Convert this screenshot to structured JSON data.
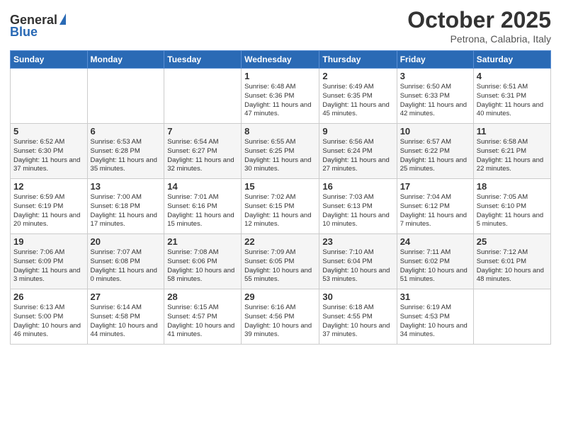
{
  "logo": {
    "general": "General",
    "blue": "Blue"
  },
  "header": {
    "month": "October 2025",
    "location": "Petrona, Calabria, Italy"
  },
  "days_of_week": [
    "Sunday",
    "Monday",
    "Tuesday",
    "Wednesday",
    "Thursday",
    "Friday",
    "Saturday"
  ],
  "weeks": [
    [
      {
        "day": "",
        "info": ""
      },
      {
        "day": "",
        "info": ""
      },
      {
        "day": "",
        "info": ""
      },
      {
        "day": "1",
        "info": "Sunrise: 6:48 AM\nSunset: 6:36 PM\nDaylight: 11 hours\nand 47 minutes."
      },
      {
        "day": "2",
        "info": "Sunrise: 6:49 AM\nSunset: 6:35 PM\nDaylight: 11 hours\nand 45 minutes."
      },
      {
        "day": "3",
        "info": "Sunrise: 6:50 AM\nSunset: 6:33 PM\nDaylight: 11 hours\nand 42 minutes."
      },
      {
        "day": "4",
        "info": "Sunrise: 6:51 AM\nSunset: 6:31 PM\nDaylight: 11 hours\nand 40 minutes."
      }
    ],
    [
      {
        "day": "5",
        "info": "Sunrise: 6:52 AM\nSunset: 6:30 PM\nDaylight: 11 hours\nand 37 minutes."
      },
      {
        "day": "6",
        "info": "Sunrise: 6:53 AM\nSunset: 6:28 PM\nDaylight: 11 hours\nand 35 minutes."
      },
      {
        "day": "7",
        "info": "Sunrise: 6:54 AM\nSunset: 6:27 PM\nDaylight: 11 hours\nand 32 minutes."
      },
      {
        "day": "8",
        "info": "Sunrise: 6:55 AM\nSunset: 6:25 PM\nDaylight: 11 hours\nand 30 minutes."
      },
      {
        "day": "9",
        "info": "Sunrise: 6:56 AM\nSunset: 6:24 PM\nDaylight: 11 hours\nand 27 minutes."
      },
      {
        "day": "10",
        "info": "Sunrise: 6:57 AM\nSunset: 6:22 PM\nDaylight: 11 hours\nand 25 minutes."
      },
      {
        "day": "11",
        "info": "Sunrise: 6:58 AM\nSunset: 6:21 PM\nDaylight: 11 hours\nand 22 minutes."
      }
    ],
    [
      {
        "day": "12",
        "info": "Sunrise: 6:59 AM\nSunset: 6:19 PM\nDaylight: 11 hours\nand 20 minutes."
      },
      {
        "day": "13",
        "info": "Sunrise: 7:00 AM\nSunset: 6:18 PM\nDaylight: 11 hours\nand 17 minutes."
      },
      {
        "day": "14",
        "info": "Sunrise: 7:01 AM\nSunset: 6:16 PM\nDaylight: 11 hours\nand 15 minutes."
      },
      {
        "day": "15",
        "info": "Sunrise: 7:02 AM\nSunset: 6:15 PM\nDaylight: 11 hours\nand 12 minutes."
      },
      {
        "day": "16",
        "info": "Sunrise: 7:03 AM\nSunset: 6:13 PM\nDaylight: 11 hours\nand 10 minutes."
      },
      {
        "day": "17",
        "info": "Sunrise: 7:04 AM\nSunset: 6:12 PM\nDaylight: 11 hours\nand 7 minutes."
      },
      {
        "day": "18",
        "info": "Sunrise: 7:05 AM\nSunset: 6:10 PM\nDaylight: 11 hours\nand 5 minutes."
      }
    ],
    [
      {
        "day": "19",
        "info": "Sunrise: 7:06 AM\nSunset: 6:09 PM\nDaylight: 11 hours\nand 3 minutes."
      },
      {
        "day": "20",
        "info": "Sunrise: 7:07 AM\nSunset: 6:08 PM\nDaylight: 11 hours\nand 0 minutes."
      },
      {
        "day": "21",
        "info": "Sunrise: 7:08 AM\nSunset: 6:06 PM\nDaylight: 10 hours\nand 58 minutes."
      },
      {
        "day": "22",
        "info": "Sunrise: 7:09 AM\nSunset: 6:05 PM\nDaylight: 10 hours\nand 55 minutes."
      },
      {
        "day": "23",
        "info": "Sunrise: 7:10 AM\nSunset: 6:04 PM\nDaylight: 10 hours\nand 53 minutes."
      },
      {
        "day": "24",
        "info": "Sunrise: 7:11 AM\nSunset: 6:02 PM\nDaylight: 10 hours\nand 51 minutes."
      },
      {
        "day": "25",
        "info": "Sunrise: 7:12 AM\nSunset: 6:01 PM\nDaylight: 10 hours\nand 48 minutes."
      }
    ],
    [
      {
        "day": "26",
        "info": "Sunrise: 6:13 AM\nSunset: 5:00 PM\nDaylight: 10 hours\nand 46 minutes."
      },
      {
        "day": "27",
        "info": "Sunrise: 6:14 AM\nSunset: 4:58 PM\nDaylight: 10 hours\nand 44 minutes."
      },
      {
        "day": "28",
        "info": "Sunrise: 6:15 AM\nSunset: 4:57 PM\nDaylight: 10 hours\nand 41 minutes."
      },
      {
        "day": "29",
        "info": "Sunrise: 6:16 AM\nSunset: 4:56 PM\nDaylight: 10 hours\nand 39 minutes."
      },
      {
        "day": "30",
        "info": "Sunrise: 6:18 AM\nSunset: 4:55 PM\nDaylight: 10 hours\nand 37 minutes."
      },
      {
        "day": "31",
        "info": "Sunrise: 6:19 AM\nSunset: 4:53 PM\nDaylight: 10 hours\nand 34 minutes."
      },
      {
        "day": "",
        "info": ""
      }
    ]
  ]
}
